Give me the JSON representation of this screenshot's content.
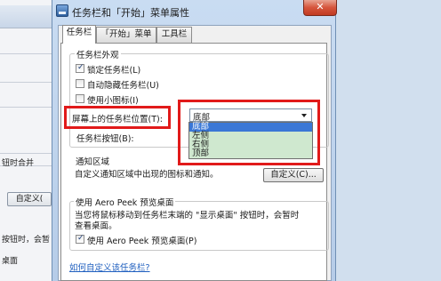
{
  "background": {
    "row1": "钮时合并",
    "button": "自定义(",
    "row2": "按钮时，会暂",
    "row3": "桌面"
  },
  "dialog": {
    "title": "任务栏和「开始」菜单属性",
    "close_glyph": "✕",
    "tabs": [
      {
        "label": "任务栏"
      },
      {
        "label": "「开始」菜单"
      },
      {
        "label": "工具栏"
      }
    ],
    "appearance": {
      "title": "任务栏外观",
      "lock": {
        "label": "锁定任务栏(L)",
        "checked": true
      },
      "autohide": {
        "label": "自动隐藏任务栏(U)",
        "checked": false
      },
      "small_icons": {
        "label": "使用小图标(I)",
        "checked": false
      },
      "location_label": "屏幕上的任务栏位置(T):",
      "location_value": "底部",
      "location_options": [
        "底部",
        "左侧",
        "右侧",
        "顶部"
      ],
      "buttons_label": "任务栏按钮(B):"
    },
    "notification": {
      "title": "通知区域",
      "desc": "自定义通知区域中出现的图标和通知。",
      "customize_button": "自定义(C)..."
    },
    "peek": {
      "title": "使用 Aero Peek 预览桌面",
      "desc_line1": "当您将鼠标移动到任务栏末端的 \"显示桌面\" 按钮时，会暂时",
      "desc_line2": "查看桌面。",
      "checkbox": {
        "label": "使用 Aero Peek 预览桌面(P)",
        "checked": true
      }
    },
    "help_link": "如何自定义该任务栏?"
  },
  "colors": {
    "highlight_box": "#e11a1a",
    "selection": "#3a77d6",
    "dropdown_bg": "#cfe8cf",
    "link": "#1f5fbf"
  }
}
